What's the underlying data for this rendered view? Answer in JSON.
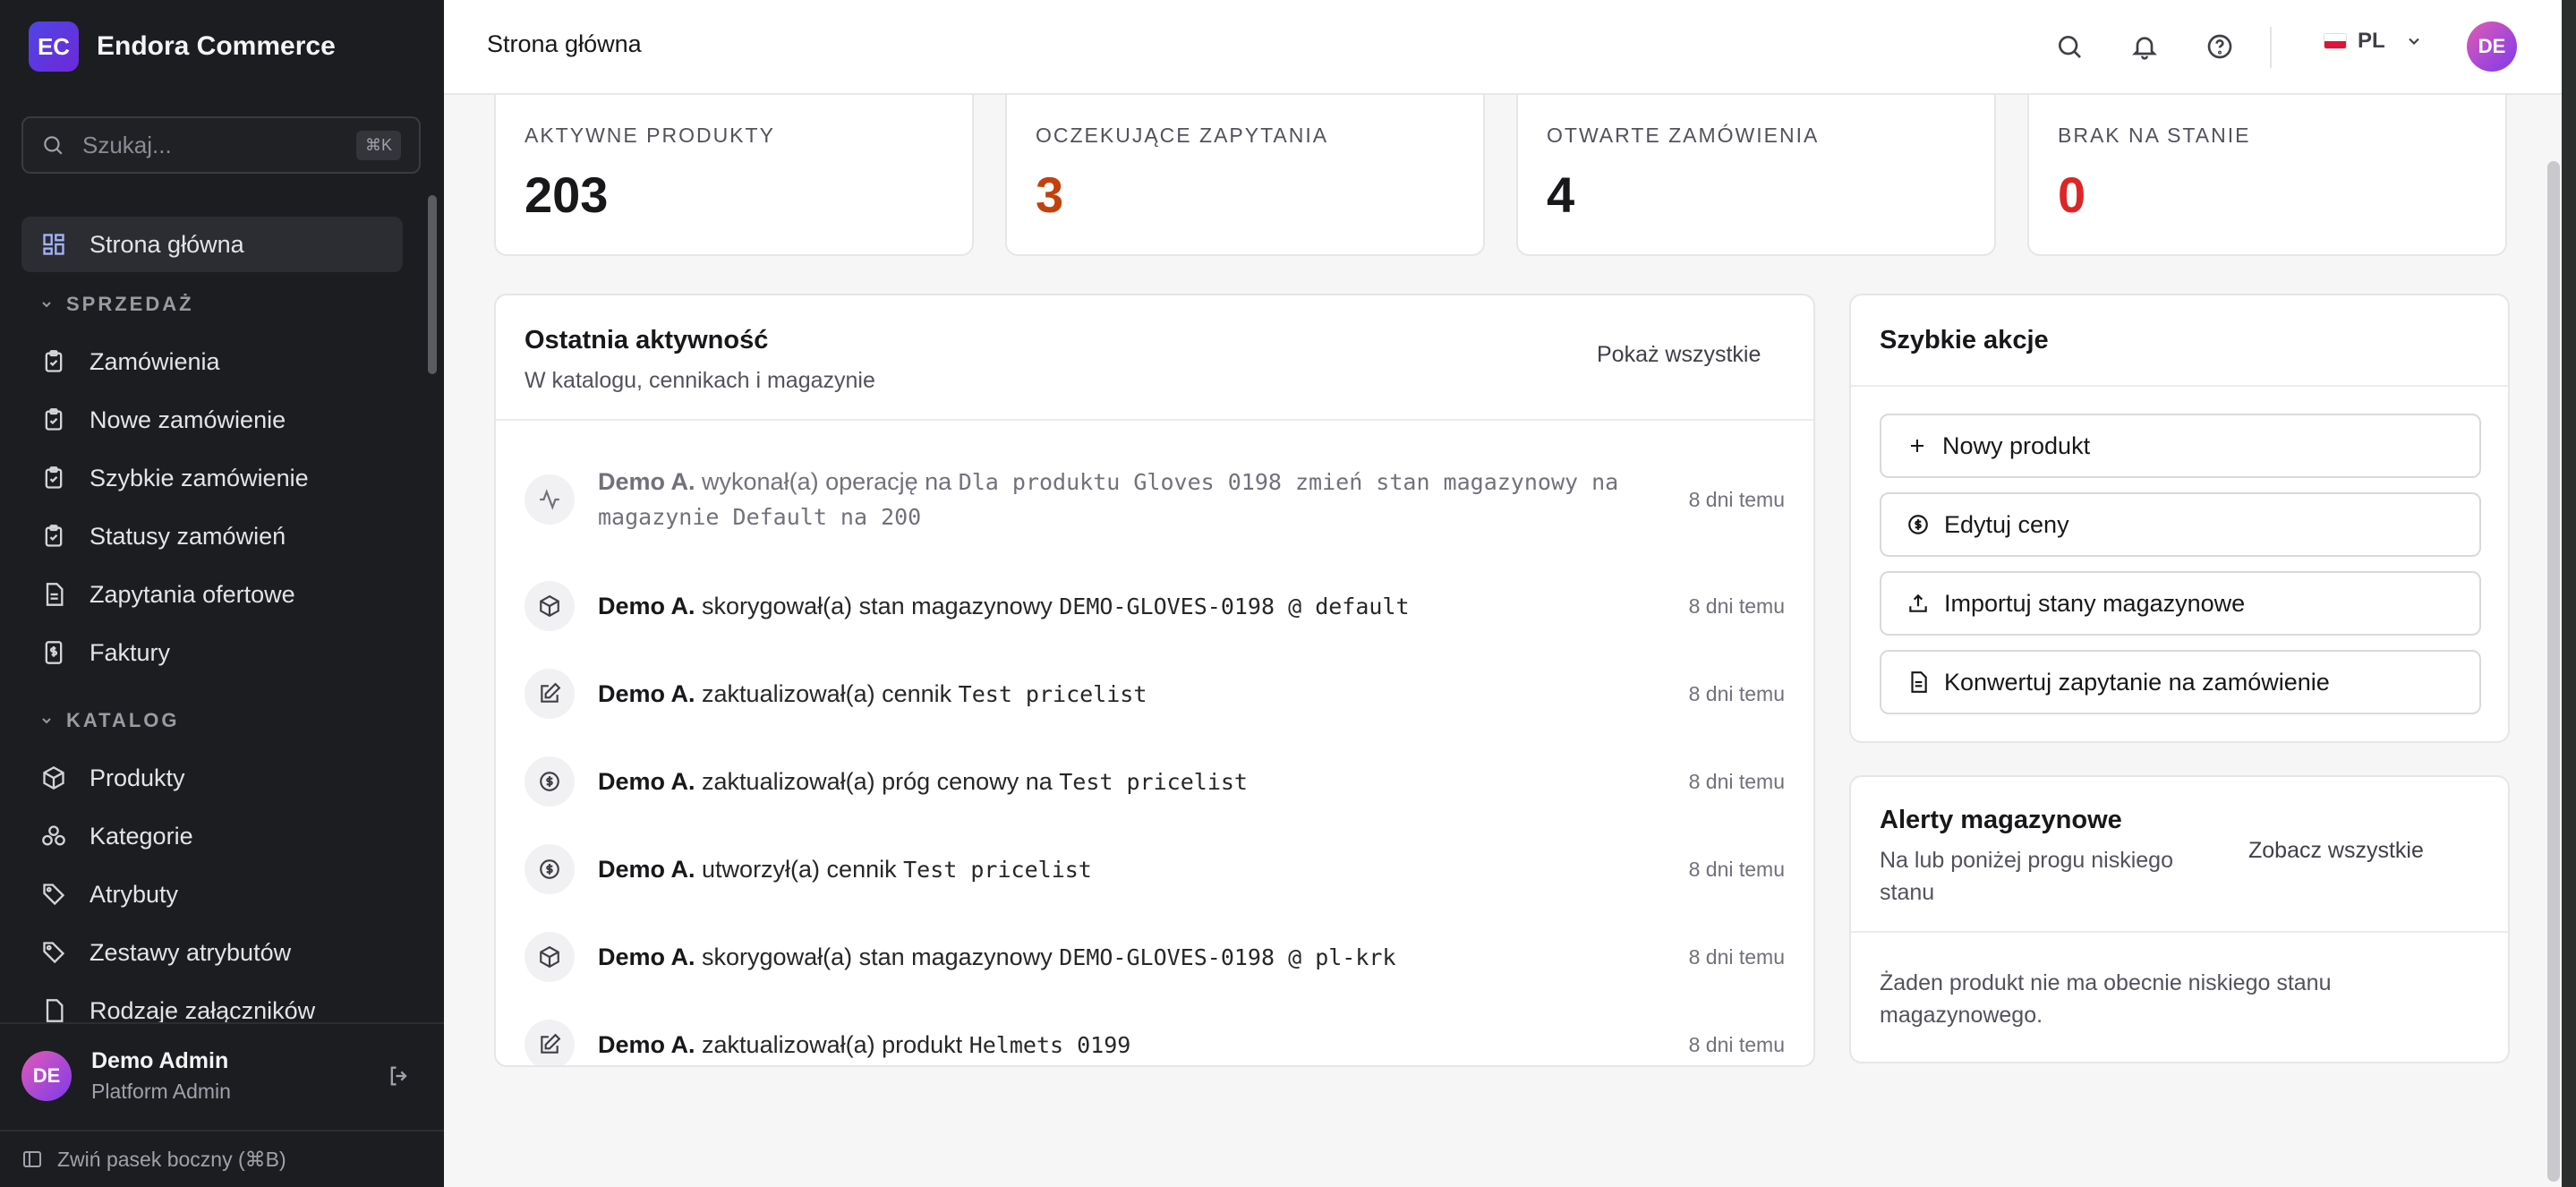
{
  "app": {
    "brand_logo": "EC",
    "brand_name": "Endora Commerce"
  },
  "sidebar": {
    "search_placeholder": "Szukaj...",
    "search_shortcut": "⌘K",
    "home": "Strona główna",
    "sections": [
      {
        "title": "SPRZEDAŻ",
        "items": [
          "Zamówienia",
          "Nowe zamówienie",
          "Szybkie zamówienie",
          "Statusy zamówień",
          "Zapytania ofertowe",
          "Faktury"
        ]
      },
      {
        "title": "KATALOG",
        "items": [
          "Produkty",
          "Kategorie",
          "Atrybuty",
          "Zestawy atrybutów",
          "Rodzaje załączników"
        ]
      }
    ],
    "user": {
      "initials": "DE",
      "name": "Demo Admin",
      "role": "Platform Admin"
    },
    "collapse_label": "Zwiń pasek boczny (⌘B)"
  },
  "topbar": {
    "title": "Strona główna",
    "language": "PL",
    "avatar_initials": "DE"
  },
  "stats": [
    {
      "label": "AKTYWNE PRODUKTY",
      "value": "203",
      "color": "#18181b"
    },
    {
      "label": "OCZEKUJĄCE ZAPYTANIA",
      "value": "3",
      "color": "#c2410c"
    },
    {
      "label": "OTWARTE ZAMÓWIENIA",
      "value": "4",
      "color": "#18181b"
    },
    {
      "label": "BRAK NA STANIE",
      "value": "0",
      "color": "#dc2626"
    }
  ],
  "activity": {
    "title": "Ostatnia aktywność",
    "subtitle": "W katalogu, cennikach i magazynie",
    "show_all": "Pokaż wszystkie",
    "rows": [
      {
        "icon": "activity-icon",
        "who": "Demo A.",
        "action": "wykonał(a) operację na",
        "target": "Dla produktu Gloves 0198 zmień stan magazynowy na magazynie Default na 200",
        "time": "8 dni temu"
      },
      {
        "icon": "package-icon",
        "who": "Demo A.",
        "action": "skorygował(a) stan magazynowy",
        "target": "DEMO-GLOVES-0198 @ default",
        "time": "8 dni temu"
      },
      {
        "icon": "edit-icon",
        "who": "Demo A.",
        "action": "zaktualizował(a) cennik",
        "target": "Test pricelist",
        "time": "8 dni temu"
      },
      {
        "icon": "dollar-icon",
        "who": "Demo A.",
        "action": "zaktualizował(a) próg cenowy na",
        "target": "Test pricelist",
        "time": "8 dni temu"
      },
      {
        "icon": "dollar-icon",
        "who": "Demo A.",
        "action": "utworzył(a) cennik",
        "target": "Test pricelist",
        "time": "8 dni temu"
      },
      {
        "icon": "package-icon",
        "who": "Demo A.",
        "action": "skorygował(a) stan magazynowy",
        "target": "DEMO-GLOVES-0198 @ pl-krk",
        "time": "8 dni temu"
      },
      {
        "icon": "edit-icon",
        "who": "Demo A.",
        "action": "zaktualizował(a) produkt",
        "target": "Helmets 0199",
        "time": "8 dni temu"
      }
    ]
  },
  "quick_actions": {
    "title": "Szybkie akcje",
    "buttons": [
      {
        "icon": "plus-icon",
        "label": "Nowy produkt"
      },
      {
        "icon": "dollar-icon",
        "label": "Edytuj ceny"
      },
      {
        "icon": "upload-icon",
        "label": "Importuj stany magazynowe"
      },
      {
        "icon": "document-icon",
        "label": "Konwertuj zapytanie na zamówienie"
      }
    ]
  },
  "stock_alerts": {
    "title": "Alerty magazynowe",
    "subtitle": "Na lub poniżej progu niskiego stanu",
    "see_all": "Zobacz wszystkie",
    "empty": "Żaden produkt nie ma obecnie niskiego stanu magazynowego."
  }
}
